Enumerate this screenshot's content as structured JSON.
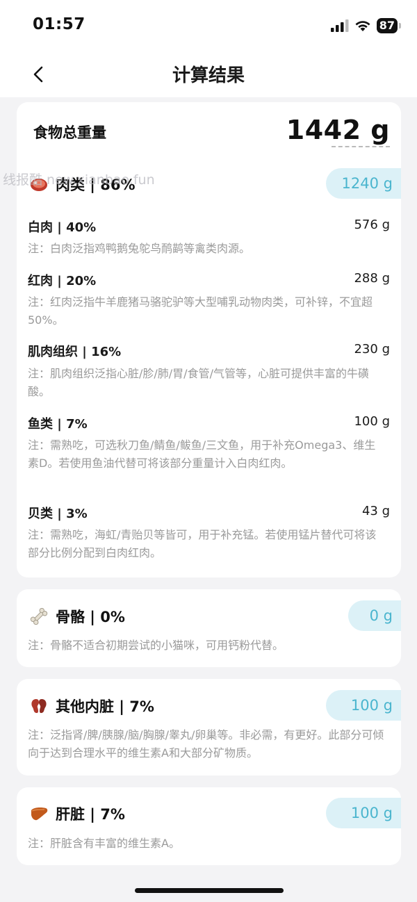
{
  "status_bar": {
    "time": "01:57",
    "battery": "87"
  },
  "nav": {
    "title": "计算结果"
  },
  "total": {
    "label": "食物总重量",
    "value": "1442 g"
  },
  "meat": {
    "title": "肉类 | 86%",
    "weight": "1240 g",
    "items": [
      {
        "name": "白肉 | 40%",
        "weight": "576 g",
        "note": "注：白肉泛指鸡鸭鹅兔鸵鸟鸸鹋等禽类肉源。"
      },
      {
        "name": "红肉 | 20%",
        "weight": "288 g",
        "note": "注：红肉泛指牛羊鹿猪马骆驼驴等大型哺乳动物肉类，可补锌，不宜超50%。"
      },
      {
        "name": "肌肉组织 | 16%",
        "weight": "230 g",
        "note": "注：肌肉组织泛指心脏/胗/肺/胃/食管/气管等，心脏可提供丰富的牛磺酸。"
      },
      {
        "name": "鱼类 | 7%",
        "weight": "100 g",
        "note": "注：需熟吃，可选秋刀鱼/鲭鱼/鲅鱼/三文鱼，用于补充Omega3、维生素D。若使用鱼油代替可将该部分重量计入白肉红肉。"
      },
      {
        "name": "贝类 | 3%",
        "weight": "43 g",
        "note": "注：需熟吃，海虹/青贻贝等皆可，用于补充锰。若使用锰片替代可将该部分比例分配到白肉红肉。"
      }
    ]
  },
  "bone": {
    "title": "骨骼 | 0%",
    "weight": "0 g",
    "note": "注：骨骼不适合初期尝试的小猫咪，可用钙粉代替。"
  },
  "organ": {
    "title": "其他内脏 | 7%",
    "weight": "100 g",
    "note": "注：泛指肾/脾/胰腺/脑/胸腺/睾丸/卵巢等。非必需，有更好。此部分可倾向于达到合理水平的维生素A和大部分矿物质。"
  },
  "liver": {
    "title": "肝脏 | 7%",
    "weight": "100 g",
    "note": "注：肝脏含有丰富的维生素A。"
  },
  "watermark": "线报酷 new.xianbao.fun",
  "colors": {
    "pill_bg": "#dcf1f7",
    "pill_text": "#4ab5ce",
    "note_text": "#9a9a9a",
    "page_bg": "#f3f3f5"
  },
  "icons": [
    "back-chevron-icon",
    "signal-icon",
    "wifi-icon",
    "battery-icon",
    "meat-icon",
    "bone-icon",
    "kidney-icon",
    "liver-icon"
  ]
}
